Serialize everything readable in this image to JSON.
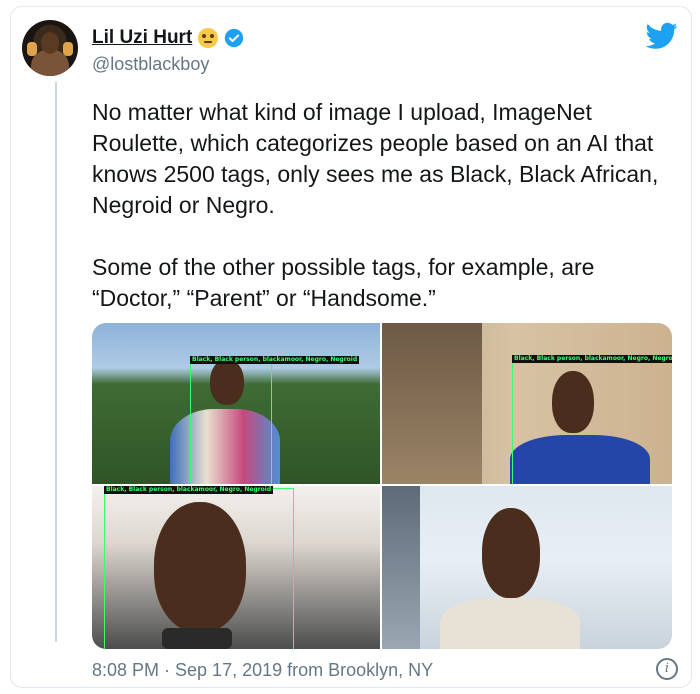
{
  "tweet": {
    "display_name": "Lil Uzi Hurt",
    "handle": "@lostblackboy",
    "text": "No matter what kind of image I upload, ImageNet Roulette, which categorizes people based on an AI that knows 2500 tags, only sees me as Black, Black African, Negroid or Negro.\n\nSome of the other possible tags, for example, are “Doctor,” “Parent” or “Handsome.”",
    "timestamp": "8:08 PM · Sep 17, 2019 from Brooklyn, NY"
  },
  "images": [
    {
      "tag_label": "Black, Black person, blackamoor, Negro, Negroid"
    },
    {
      "tag_label": "Black, Black person, blackamoor, Negro, Negroid"
    },
    {
      "tag_label": "Black, Black person, blackamoor, Negro, Negroid"
    },
    {
      "tag_label": ""
    }
  ],
  "icons": {
    "verified": "verified-badge-icon",
    "emoji": "face-with-rolling-eyes-emoji",
    "brand": "twitter-bird-icon",
    "info": "info-icon"
  },
  "colors": {
    "accent": "#1da1f2",
    "detection_box": "#39ff6a",
    "secondary_text": "#657786"
  }
}
